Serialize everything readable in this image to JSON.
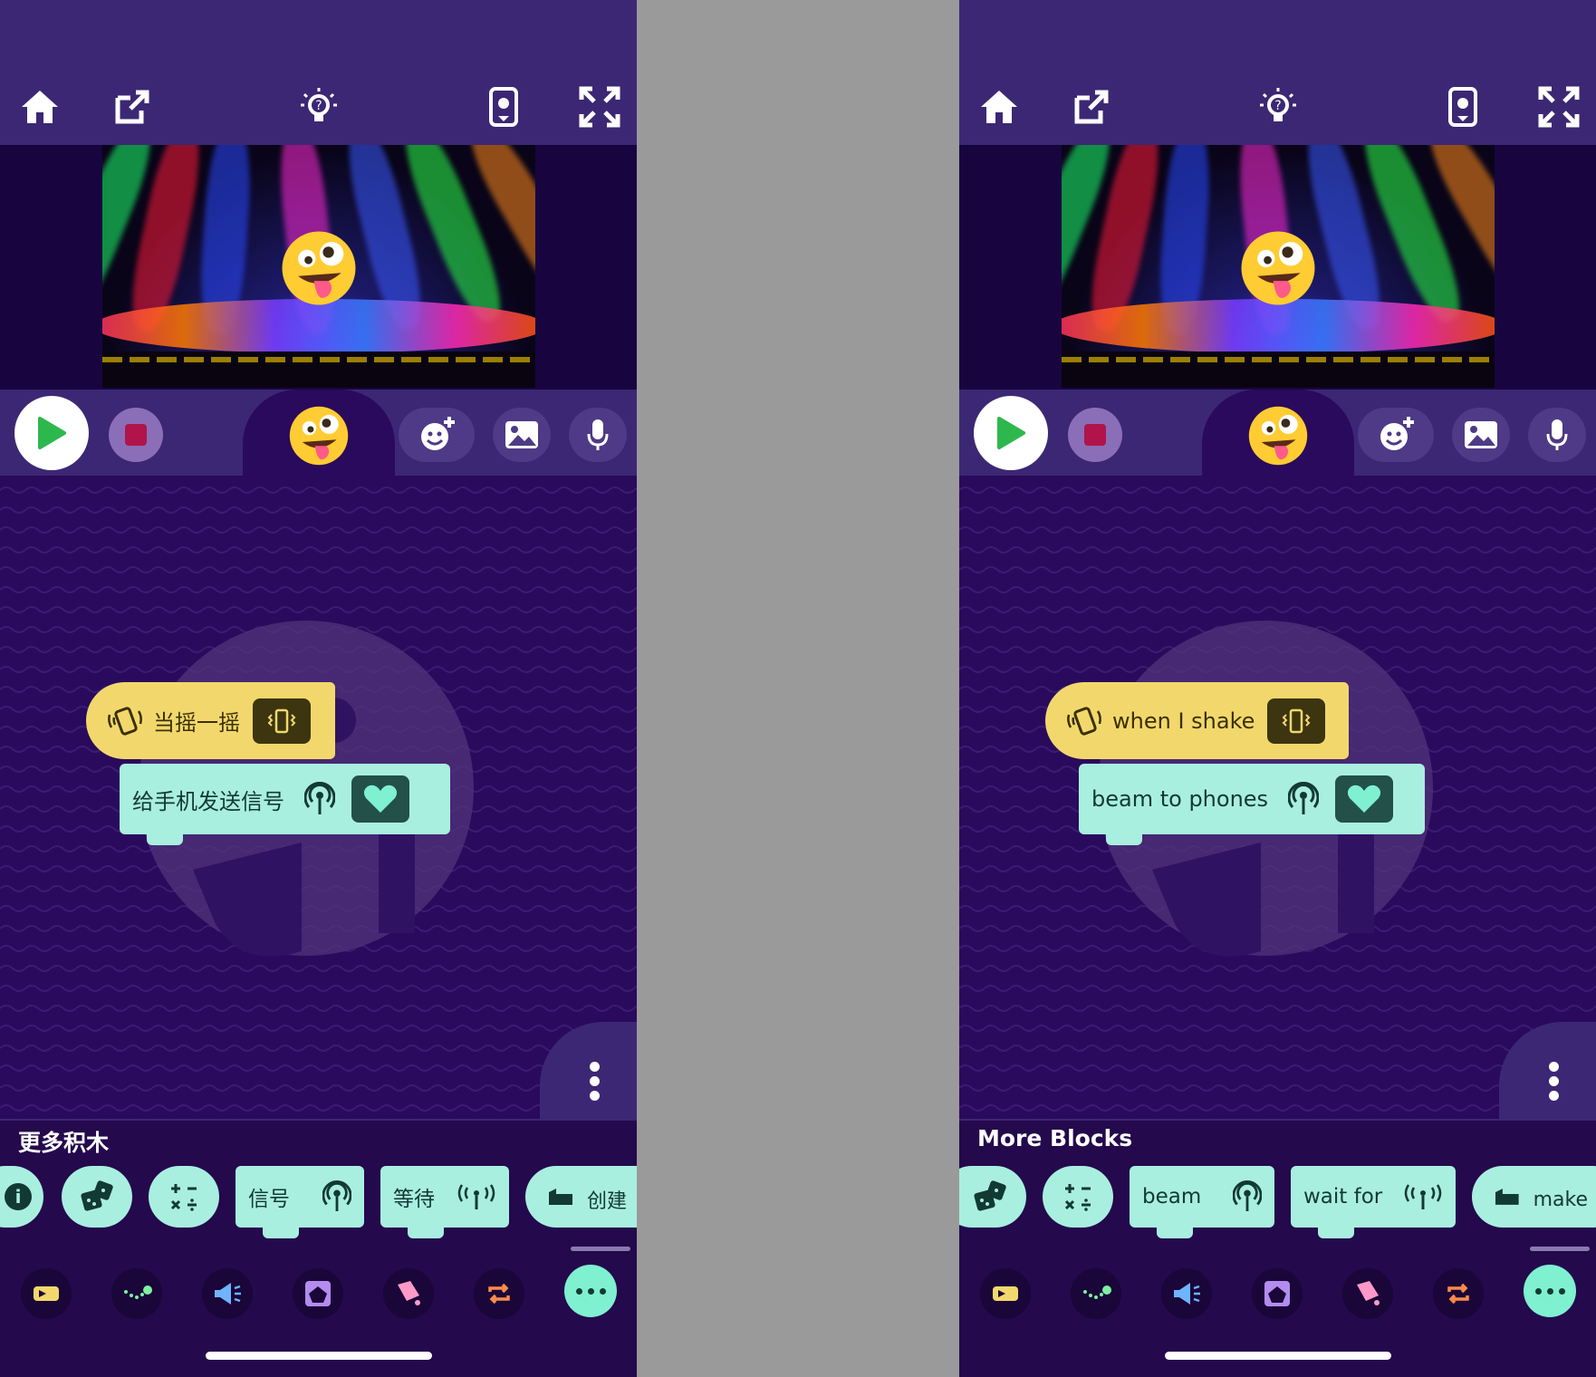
{
  "screens": [
    {
      "id": "left",
      "more_blocks_title": "更多积木",
      "hat_block_label": "当摇一摇",
      "command_block_label": "给手机发送信号",
      "palette": {
        "beam_label": "信号",
        "wait_label": "等待",
        "make_label": "创建"
      }
    },
    {
      "id": "right",
      "more_blocks_title": "More Blocks",
      "hat_block_label": "when I shake",
      "command_block_label": "beam to phones",
      "palette": {
        "beam_label": "beam",
        "wait_label": "wait for",
        "make_label": "make"
      }
    }
  ],
  "icons": {
    "toolbar": [
      "home-icon",
      "share-icon",
      "lightbulb-hint-icon",
      "phone-preview-icon",
      "fullscreen-icon"
    ],
    "controls": [
      "play-icon",
      "stop-icon",
      "sprite-emoji-icon",
      "add-sprite-icon",
      "backdrop-image-icon",
      "microphone-icon"
    ],
    "categories": [
      "events-icon",
      "motion-icon",
      "sound-icon",
      "looks-icon",
      "paint-icon",
      "control-icon",
      "more-categories-icon"
    ]
  },
  "colors": {
    "topbar": "#3c2774",
    "workspace": "#2a0a5c",
    "hat_block": "#f2d86c",
    "command_block": "#a9efe0",
    "play_green": "#2db84d",
    "stop_red": "#b0144a"
  }
}
